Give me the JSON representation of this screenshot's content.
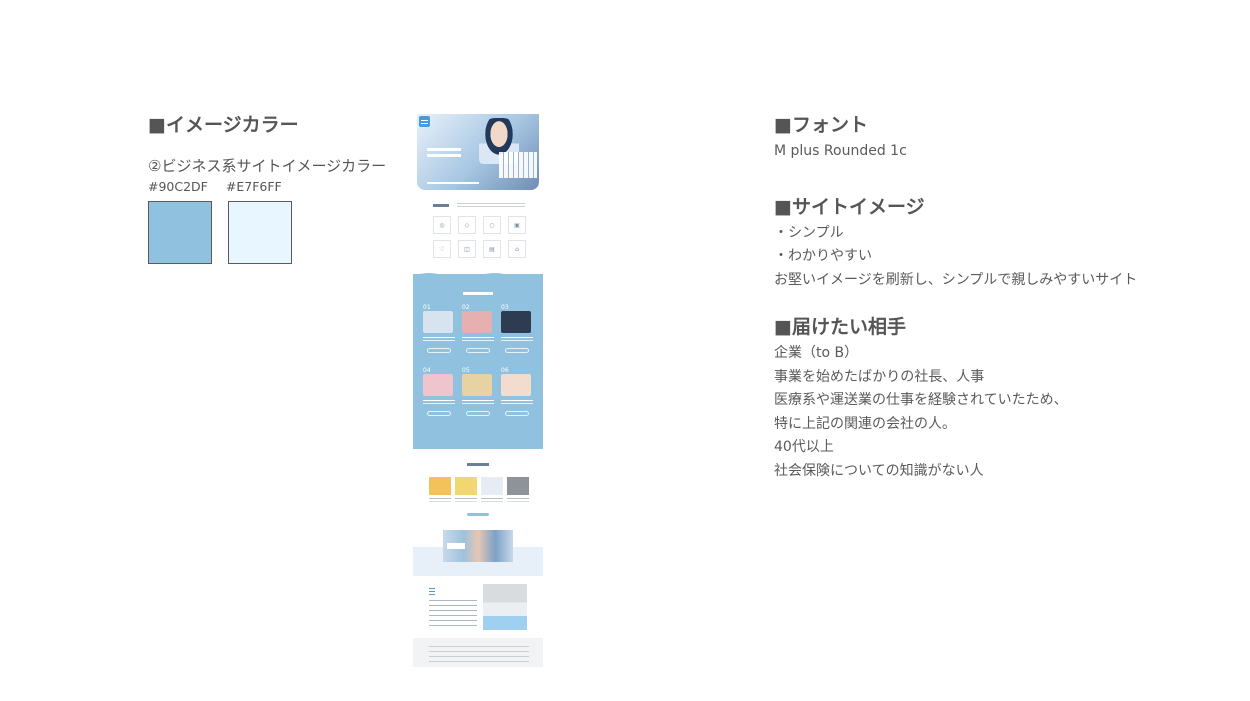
{
  "color_section": {
    "heading": "■イメージカラー",
    "subtitle": "②ビジネス系サイトイメージカラー",
    "swatches": [
      {
        "hex_label": "#90C2DF",
        "color": "#90c2df"
      },
      {
        "hex_label": "#E7F6FF",
        "color": "#e7f6ff"
      }
    ]
  },
  "font_section": {
    "heading": "■フォント",
    "lines": [
      "M plus Rounded 1c"
    ]
  },
  "image_section": {
    "heading": "■サイトイメージ",
    "lines": [
      "・シンプル",
      "・わかりやすい",
      "お堅いイメージを刷新し、シンプルで親しみやすいサイト"
    ]
  },
  "target_section": {
    "heading": "■届けたい相手",
    "lines": [
      "企業（to B）",
      "事業を始めたばかりの社長、人事",
      "医療系や運送業の仕事を経験されていたため、",
      "特に上記の関連の会社の人。",
      "40代以上",
      "社会保険についての知識がない人"
    ]
  },
  "thumbnail": {
    "card_numbers": [
      "01",
      "02",
      "03",
      "04",
      "05",
      "06"
    ],
    "card_colors": [
      "#d7e3ee",
      "#e7b0b0",
      "#2e3c52",
      "#f0c4cd",
      "#e7d2a4",
      "#f1dcce"
    ],
    "news_colors": [
      "#f3c25a",
      "#f0d770",
      "#e6ecf4",
      "#8e939a"
    ],
    "accent": "#90c2df"
  }
}
